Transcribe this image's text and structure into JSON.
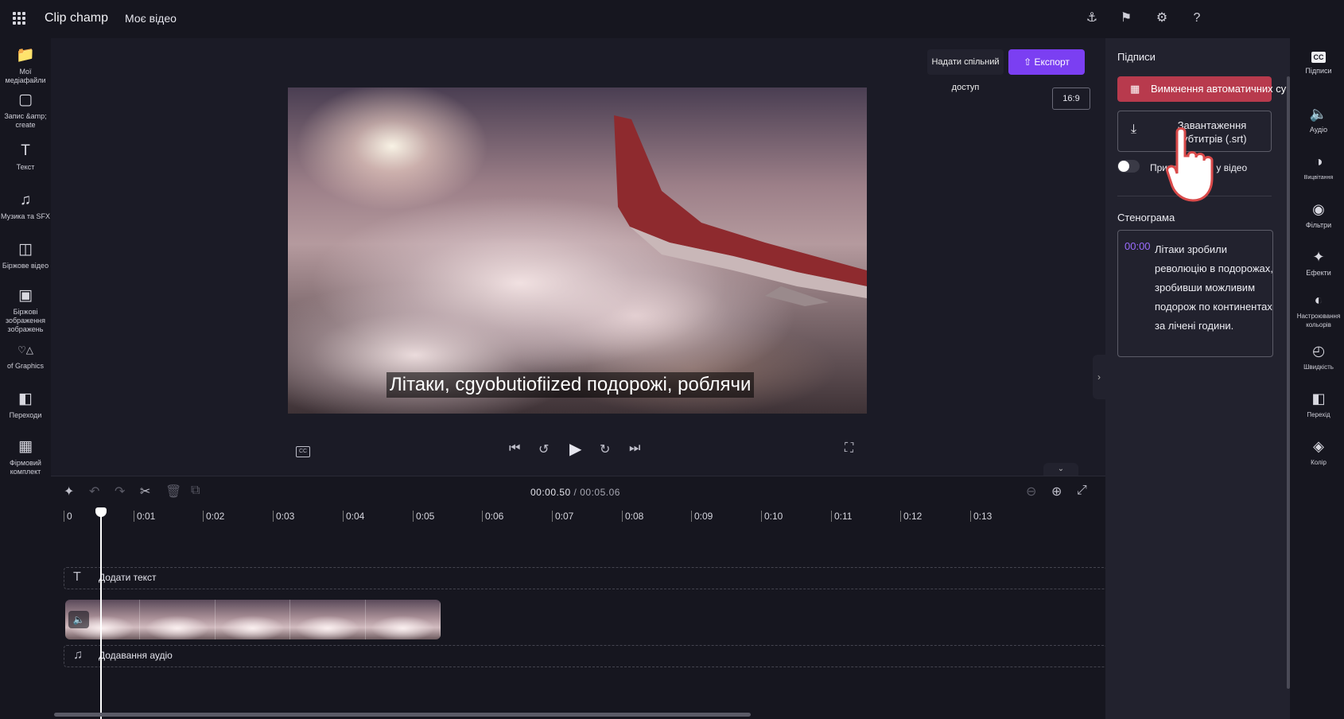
{
  "topbar": {
    "app_title": "Clip champ",
    "nav_my_video": "Моє відео"
  },
  "sidebar": {
    "items": [
      {
        "label": "Мої медіафайли",
        "icon": "folder-icon"
      },
      {
        "label": "Запис &amp; create",
        "icon": "camera-icon"
      },
      {
        "label": "Текст",
        "icon": "text-icon"
      },
      {
        "label": "Музика та SFX",
        "icon": "music-icon"
      },
      {
        "label": "Біржове відео",
        "icon": "film-icon"
      },
      {
        "label": "Біржові зображення зображень",
        "icon": "image-icon"
      },
      {
        "label": "of Graphics",
        "icon": "shapes-icon"
      },
      {
        "label": "Переходи",
        "icon": "transition-icon"
      },
      {
        "label": "Фірмовий комплект",
        "icon": "brand-kit-icon"
      }
    ]
  },
  "stage": {
    "share_label": "Надати спільний доступ",
    "export_label": "Експорт",
    "aspect_ratio": "16:9",
    "subtitle_text": "Літаки, cgyobutiofiized подорожі, роблячи"
  },
  "timeline": {
    "current_time": "00:00.50",
    "separator": " / ",
    "total_time": "00:05.06",
    "ticks": [
      "0",
      "0:01",
      "0:02",
      "0:03",
      "0:04",
      "0:05",
      "0:06",
      "0:07",
      "0:08",
      "0:09",
      "0:10",
      "0:11",
      "0:12",
      "0:13"
    ],
    "add_text_label": "Додати текст",
    "add_audio_label": "Додавання аудіо"
  },
  "captions_panel": {
    "title": "Підписи",
    "disable_auto_label": "Вимкнення автоматичних субтитрів",
    "download_label": "Завантаження субтитрів (.srt)",
    "toggle_label": "Приховати CC у відео",
    "transcript_title": "Стенограма",
    "transcript_time": "00:00",
    "transcript_text": "Літаки зробили революцію в подорожах, зробивши можливим подорож по континентах за лічені години."
  },
  "rightbar": {
    "items": [
      {
        "label": "Підписи",
        "icon": "cc-icon"
      },
      {
        "label": "Аудіо",
        "icon": "speaker-icon"
      },
      {
        "label": "Вицвітання",
        "icon": "fade-icon"
      },
      {
        "label": "Фільтри",
        "icon": "filters-icon"
      },
      {
        "label": "Ефекти",
        "icon": "magic-wand-icon"
      },
      {
        "label": "Настроювання кольорів",
        "icon": "color-adjust-icon"
      },
      {
        "label": "Швидкість",
        "icon": "speedometer-icon"
      },
      {
        "label": "Перехід",
        "icon": "transition-icon"
      },
      {
        "label": "Колір",
        "icon": "palette-icon"
      }
    ]
  },
  "colors": {
    "accent_purple": "#7b3ff2",
    "disable_button_red": "#b83a4d",
    "timestamp_purple": "#9b6cff"
  }
}
